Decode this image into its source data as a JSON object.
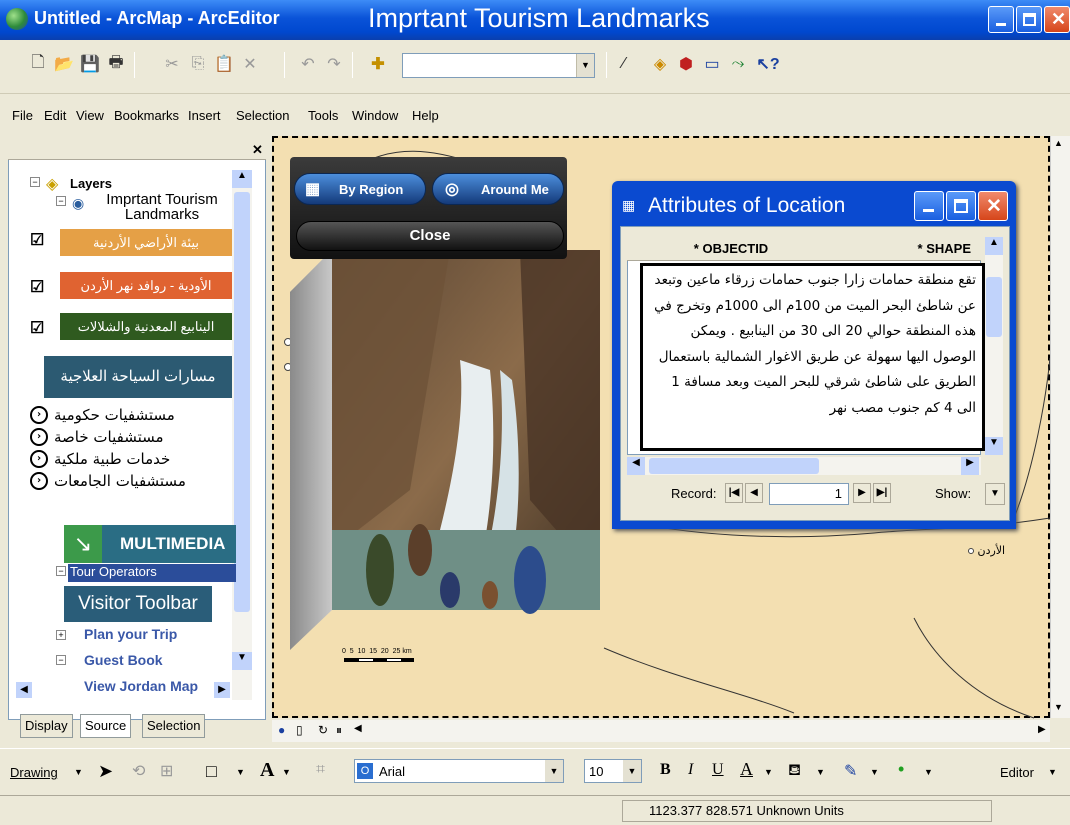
{
  "window": {
    "app_title": "Untitled - ArcMap - ArcEditor",
    "map_title": "Imprtant Tourism Landmarks"
  },
  "menus": [
    "File",
    "Edit",
    "View",
    "Bookmarks",
    "Insert",
    "Selection",
    "Tools",
    "Window",
    "Help"
  ],
  "toc": {
    "root": "Layers",
    "group": "Imprtant Tourism Landmarks",
    "layers": [
      {
        "label": "بيئة الأراضي الأردنية",
        "color": "#e5a046",
        "checked": true
      },
      {
        "label": "الأودية - روافد نهر الأردن",
        "color": "#e06331",
        "checked": true
      },
      {
        "label": "الينابيع المعدنية والشلالات",
        "color": "#2f5a1f",
        "checked": true
      }
    ],
    "therapeutic_routes": "مسارات السياحة العلاجية",
    "hospitals": [
      "مستشفيات حكومية",
      "مستشفيات خاصة",
      "خدمات طبية ملكية",
      "مستشفيات الجامعات"
    ],
    "multimedia": "MULTIMEDIA",
    "tour_operators": "Tour Operators",
    "visitor_toolbar": "Visitor Toolbar",
    "links": [
      "Plan your Trip",
      "Guest Book",
      "View Jordan Map"
    ]
  },
  "tabs": [
    "Display",
    "Source",
    "Selection"
  ],
  "popup": {
    "by_region": "By Region",
    "around_me": "Around Me",
    "close": "Close"
  },
  "attributes": {
    "title": "Attributes of Location",
    "col1": "* OBJECTID",
    "col2": "* SHAPE",
    "text": "تقع منطقة حمامات زارا جنوب حمامات زرقاء ماعين وتبعد عن شاطئ البحر الميت من 100م الى 1000م وتخرج في هذه المنطقة حوالي 20 الى 30 من الينابيع . ويمكن الوصول اليها سهولة عن طريق الاغوار الشمالية باستعمال الطريق على شاطئ شرقي للبحر الميت وبعد مسافة 1 الى 4 كم جنوب مصب نهر",
    "record_label": "Record:",
    "record_value": "1",
    "show_label": "Show:"
  },
  "map": {
    "label_jordan": "الأردن",
    "scale_labels": "0  5  10  15  20  25 km"
  },
  "drawing": {
    "drawing_label": "Drawing",
    "font_name": "Arial",
    "font_size": "10",
    "editor_label": "Editor"
  },
  "status": {
    "coords": "1123.377  828.571 Unknown Units"
  },
  "colors": {
    "titlebar": "#0a53d8",
    "map_background": "#f3dfb1",
    "attr_title": "#0a4ad0"
  }
}
